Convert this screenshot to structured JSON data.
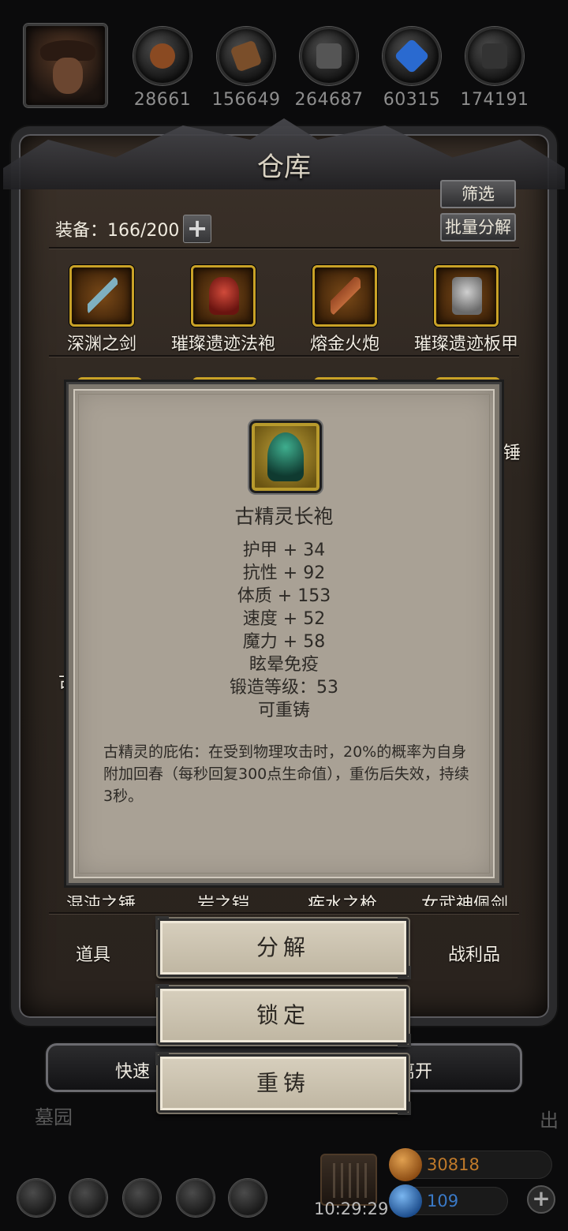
{
  "resources": [
    {
      "icon": "meat-icon",
      "value": "28661",
      "color": "#8a4a22"
    },
    {
      "icon": "wood-icon",
      "value": "156649",
      "color": "#7a4e2a"
    },
    {
      "icon": "iron-icon",
      "value": "264687",
      "color": "#4a4a4a"
    },
    {
      "icon": "crystal-icon",
      "value": "60315",
      "color": "#2a6ad0"
    },
    {
      "icon": "coal-icon",
      "value": "174191",
      "color": "#2b2b2b"
    }
  ],
  "warehouse": {
    "title": "仓库",
    "filter_label": "筛选",
    "batch_label": "批量分解",
    "equip_label": "装备：166/200",
    "items_row1": [
      {
        "name": "深渊之剑",
        "color": "#7fb0c0"
      },
      {
        "name": "璀璨遗迹法袍",
        "color": "#b02a22"
      },
      {
        "name": "熔金火炮",
        "color": "#9a4a26"
      },
      {
        "name": "璀璨遗迹板甲",
        "color": "#9a9a9a"
      }
    ],
    "peek_right": "锤",
    "peek_left": "古",
    "items_bottom_partial": [
      "混沌之锤",
      "岩之铠",
      "疾水之枪",
      "女武神佩剑"
    ],
    "tab_left": "道具",
    "tab_right": "战利品"
  },
  "tooltip": {
    "item_name": "古精灵长袍",
    "stats": [
      "护甲 + 34",
      "抗性 + 92",
      "体质 + 153",
      "速度 + 52",
      "魔力 + 58",
      "眩晕免疫",
      "锻造等级：53",
      "可重铸"
    ],
    "description": "古精灵的庇佑：在受到物理攻击时，20%的概率为自身附加回春（每秒回复300点生命值），重伤后失效，持续3秒。"
  },
  "actions": {
    "decompose": "分解",
    "lock": "锁定",
    "reforge": "重铸"
  },
  "bottom": {
    "quick_label": "快速",
    "leave_label": "离开",
    "graveyard": "墓园",
    "exit_partial": "出",
    "time": "10:29:29",
    "gold": "30818",
    "gold_color": "#c07a2a",
    "gems": "109",
    "gems_color": "#3a7ac8"
  }
}
